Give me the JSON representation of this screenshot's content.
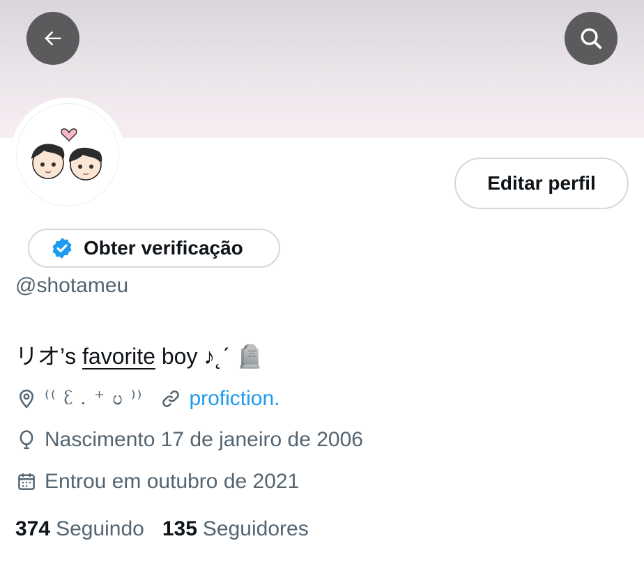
{
  "header": {
    "back_icon": "arrow-left-icon",
    "search_icon": "search-icon",
    "banner_colors": [
      "#d9d5da",
      "#f7eef3"
    ]
  },
  "profile": {
    "avatar_desc_icon": "avatar-illustration-icon",
    "edit_label": "Editar perfil",
    "verify_label": "Obter verificação",
    "verify_badge_color": "#1d9bf0",
    "handle": "@shotameu",
    "bio_prefix": "リオ’s ",
    "bio_underlined": "favorite",
    "bio_suffix": " boy ♪˛ˊ 🪦"
  },
  "meta": {
    "location": "⁽⁽ ᦷ . ⁺  ᦢ ⁾⁾",
    "link": "profiction.",
    "birth": "Nascimento 17 de janeiro de 2006",
    "joined": "Entrou em outubro de 2021"
  },
  "stats": {
    "following_count": "374",
    "following_label": "Seguindo",
    "followers_count": "135",
    "followers_label": "Seguidores"
  }
}
